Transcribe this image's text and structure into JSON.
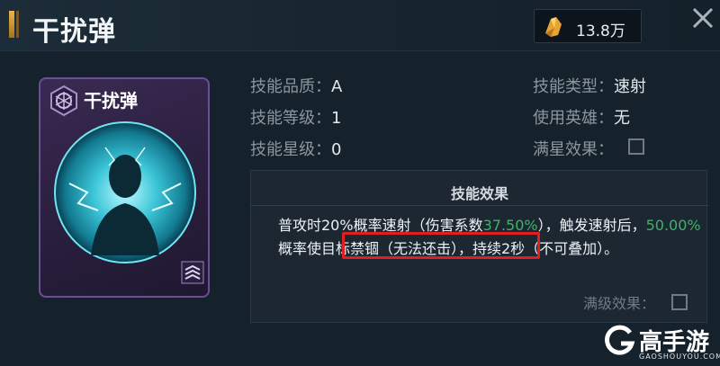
{
  "header": {
    "title": "干扰弹",
    "currency_amount": "13.8万"
  },
  "card": {
    "name": "干扰弹"
  },
  "attributes": {
    "quality_label": "技能品质：",
    "quality_value": "A",
    "level_label": "技能等级：",
    "level_value": "1",
    "star_label": "技能星级：",
    "star_value": "0",
    "type_label": "技能类型：",
    "type_value": "速射",
    "hero_label": "使用英雄：",
    "hero_value": "无",
    "fullstar_label": "满星效果："
  },
  "effect": {
    "title": "技能效果",
    "d1": "普攻时20%概率速射（伤害系数",
    "d2": "37.50%",
    "d3": "），触发速射后，",
    "d4": "50.00%",
    "d5": "概率使目标禁锢（无法还击），持续2秒（不可叠加）。",
    "max_label": "满级效果："
  },
  "watermark": {
    "brand": "高手游",
    "site": "GAOSHOUYOU.COM"
  },
  "colors": {
    "accent_green": "#3fb36a",
    "highlight_red": "#e02020",
    "card_purple": "#6b4e96"
  }
}
